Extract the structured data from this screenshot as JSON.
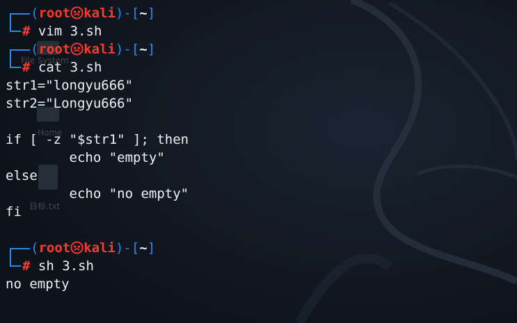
{
  "desktop": {
    "file_system_label": "File System",
    "home_label": "Home",
    "file_label": "目标.txt"
  },
  "prompt": {
    "user": "root",
    "separator_icon": "skull-icon",
    "host": "kali",
    "dir": "~",
    "symbol": "#"
  },
  "session": [
    {
      "command": "vim 3.sh",
      "output": []
    },
    {
      "command": "cat 3.sh",
      "output": [
        "str1=\"longyu666\"",
        "str2=\"Longyu666\"",
        "",
        "if [ -z \"$str1\" ]; then",
        "        echo \"empty\"",
        "else",
        "        echo \"no empty\"",
        "fi",
        ""
      ]
    },
    {
      "command": "sh 3.sh",
      "output": [
        "no empty"
      ]
    }
  ],
  "colors": {
    "background": "#111821",
    "prompt_blue": "#2f87e6",
    "prompt_red": "#ff3b2f",
    "text": "#f2f2f2"
  }
}
